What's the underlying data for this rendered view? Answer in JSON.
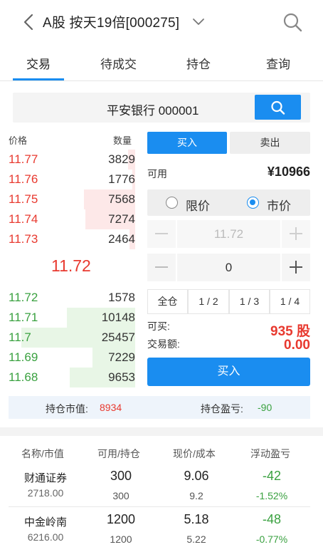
{
  "header": {
    "title": "A股 按天19倍[000275]",
    "icons": [
      "back-arrow-icon",
      "chevron-down-icon",
      "search-icon"
    ]
  },
  "tabs": [
    {
      "label": "交易",
      "active": true
    },
    {
      "label": "待成交",
      "active": false
    },
    {
      "label": "持仓",
      "active": false
    },
    {
      "label": "查询",
      "active": false
    }
  ],
  "stock_search": {
    "value": "平安银行 000001",
    "button_icon": "search-icon"
  },
  "order_book": {
    "price_header": "价格",
    "qty_header": "数量",
    "asks": [
      {
        "price": "11.77",
        "qty": "3829"
      },
      {
        "price": "11.76",
        "qty": "1776"
      },
      {
        "price": "11.75",
        "qty": "7568"
      },
      {
        "price": "11.74",
        "qty": "7274"
      },
      {
        "price": "11.73",
        "qty": "2464"
      }
    ],
    "last_price": "11.72",
    "bids": [
      {
        "price": "11.72",
        "qty": "1578"
      },
      {
        "price": "11.71",
        "qty": "10148"
      },
      {
        "price": "11.7",
        "qty": "25457"
      },
      {
        "price": "11.69",
        "qty": "7229"
      },
      {
        "price": "11.68",
        "qty": "9653"
      }
    ]
  },
  "order_form": {
    "buy_tab": "买入",
    "sell_tab": "卖出",
    "available_label": "可用",
    "available_value": "¥10966",
    "limit_label": "限价",
    "market_label": "市价",
    "selected_type": "market",
    "price_value": "11.72",
    "quantity_value": "0",
    "ratios": [
      "全仓",
      "1 / 2",
      "1 / 3",
      "1 / 4"
    ],
    "can_buy_label": "可买:",
    "can_buy_value": "935 股",
    "amount_label": "交易额:",
    "amount_value": "0.00",
    "submit_label": "买入"
  },
  "summary": {
    "market_value_label": "持仓市值:",
    "market_value": "8934",
    "pnl_label": "持仓盈亏:",
    "pnl_value": "-90"
  },
  "positions": {
    "headers": [
      "名称/市值",
      "可用/持仓",
      "现价/成本",
      "浮动盈亏"
    ],
    "rows": [
      {
        "name": "财通证券",
        "market_value": "2718.00",
        "available": "300",
        "holding": "300",
        "price": "9.06",
        "cost": "9.2",
        "pnl": "-42",
        "pnl_pct": "-1.52%"
      },
      {
        "name": "中金岭南",
        "market_value": "6216.00",
        "available": "1200",
        "holding": "1200",
        "price": "5.18",
        "cost": "5.22",
        "pnl": "-48",
        "pnl_pct": "-0.77%"
      }
    ]
  },
  "colors": {
    "accent": "#1a8df0",
    "up_red": "#e8392f",
    "down_green": "#3aa140",
    "ask_bar": "#fde8e8",
    "bid_bar": "#e8f6e6"
  }
}
